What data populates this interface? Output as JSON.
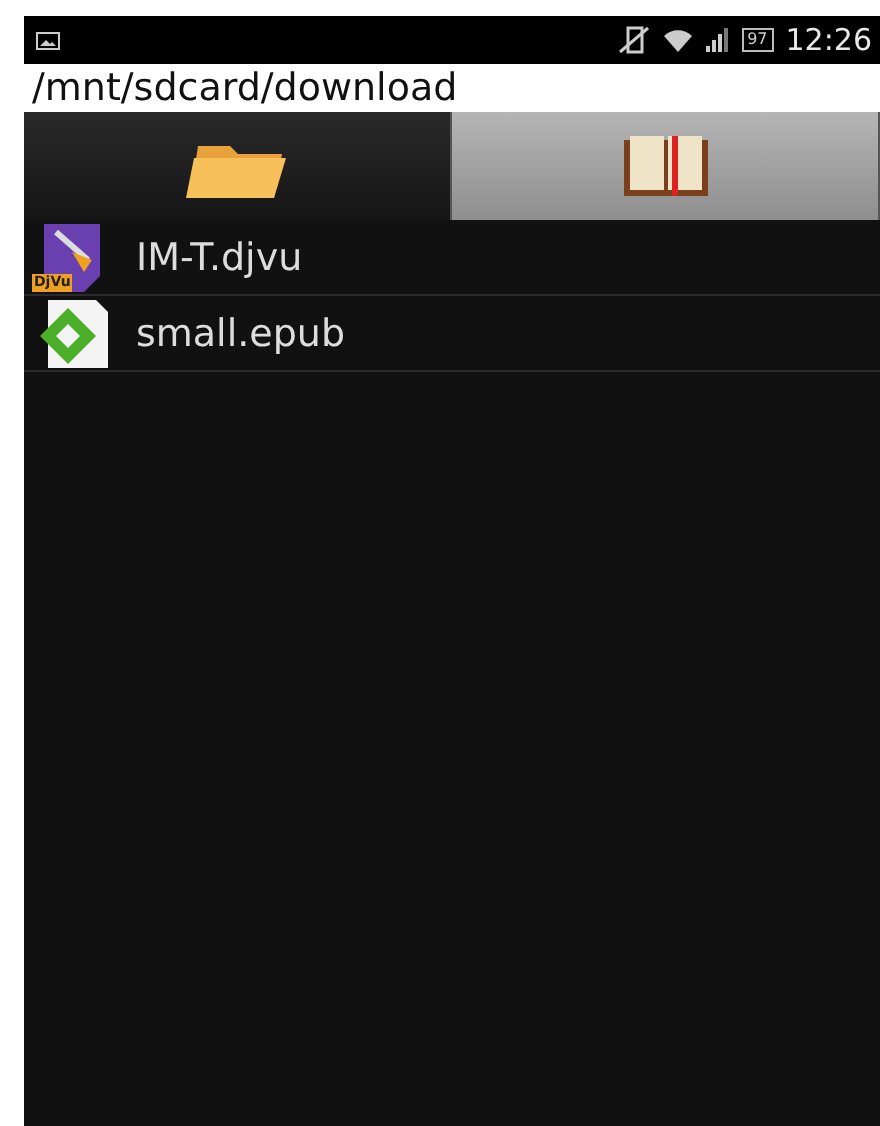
{
  "status_bar": {
    "battery": "97",
    "time": "12:26"
  },
  "path": "/mnt/sdcard/download",
  "tabs": [
    {
      "kind": "folder",
      "selected": true
    },
    {
      "kind": "book",
      "selected": false
    }
  ],
  "files": [
    {
      "name": "IM-T.djvu",
      "kind": "djvu",
      "badge": "DjVu"
    },
    {
      "name": "small.epub",
      "kind": "epub"
    }
  ]
}
